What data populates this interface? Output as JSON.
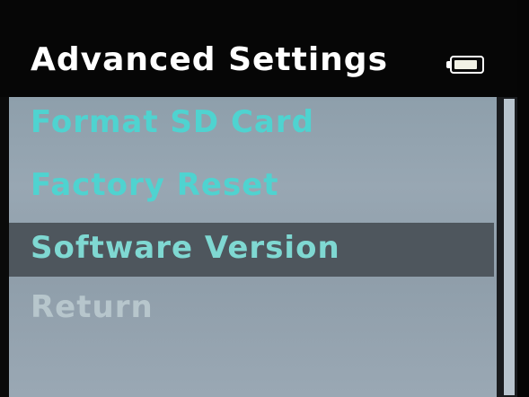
{
  "header": {
    "title": "Advanced Settings",
    "battery_icon": "battery-icon",
    "battery_level": 0.9
  },
  "menu": {
    "items": [
      {
        "label": "Format SD Card",
        "state": "normal"
      },
      {
        "label": "Factory Reset",
        "state": "normal"
      },
      {
        "label": "Software Version",
        "state": "selected"
      },
      {
        "label": "Return",
        "state": "dim"
      }
    ]
  },
  "colors": {
    "label": "#4fd3d0",
    "selected_row": "#4e565d",
    "panel": "#95a4b0",
    "title": "#ffffff"
  }
}
